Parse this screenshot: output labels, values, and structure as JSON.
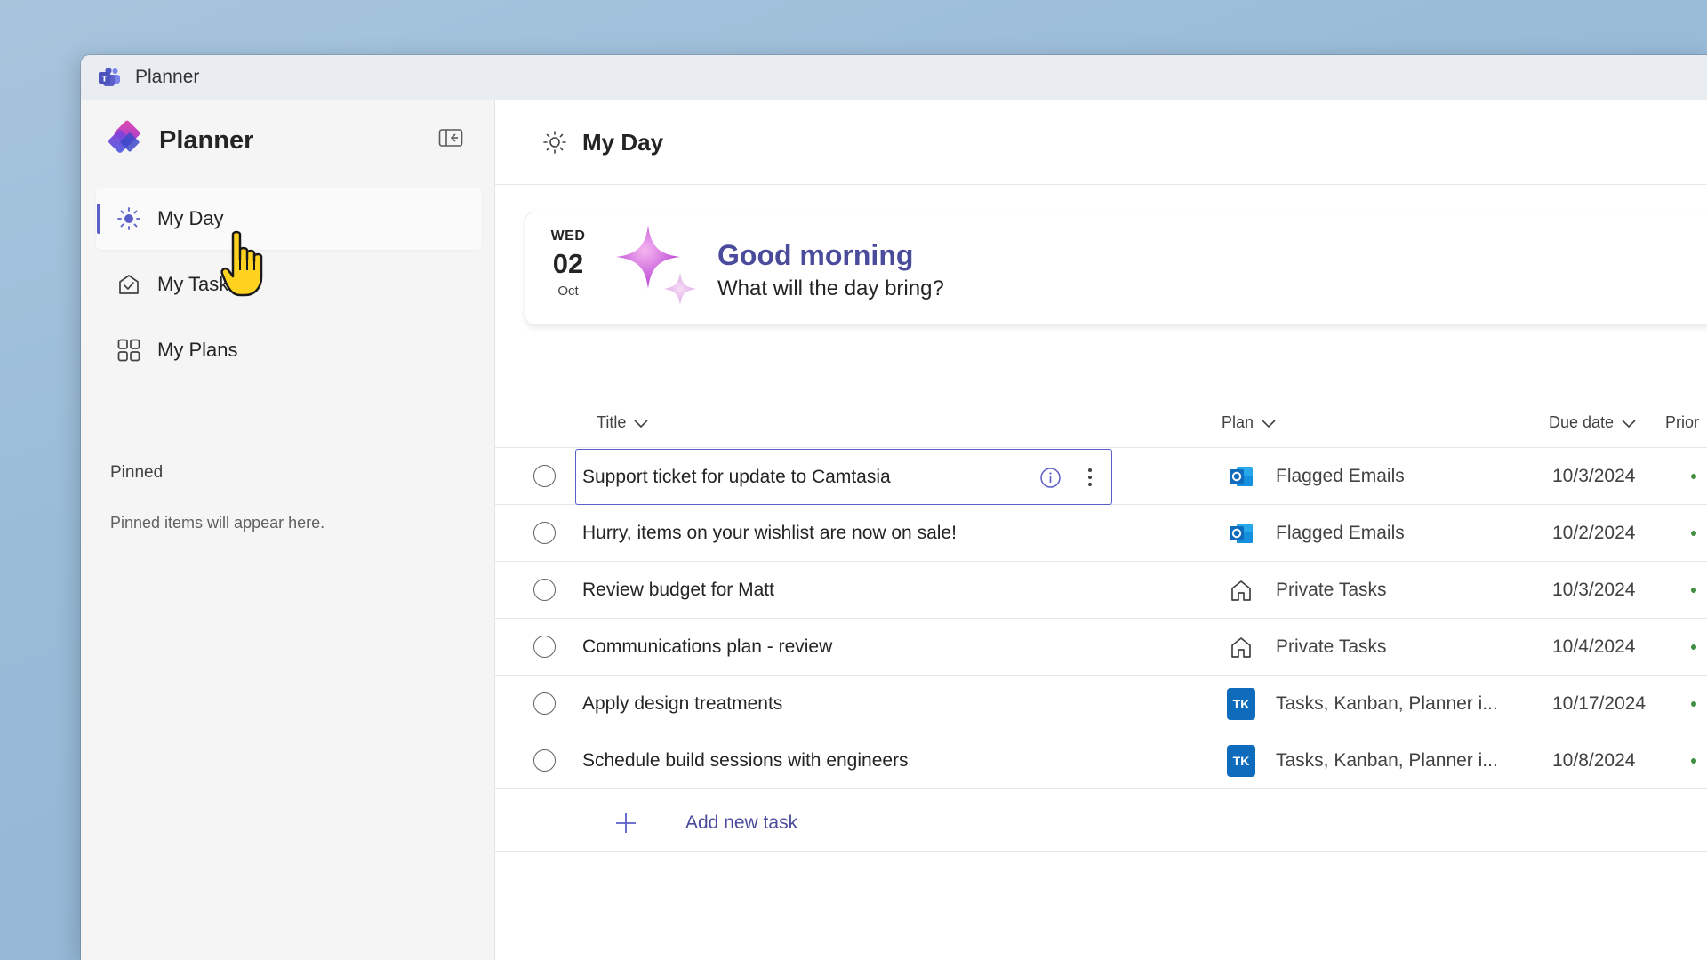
{
  "window": {
    "title": "Planner"
  },
  "sidebar": {
    "brand": "Planner",
    "nav": [
      {
        "label": "My Day",
        "icon": "sun-icon",
        "active": true
      },
      {
        "label": "My Tasks",
        "icon": "task-icon",
        "active": false
      },
      {
        "label": "My Plans",
        "icon": "grid-icon",
        "active": false
      }
    ],
    "pinned_title": "Pinned",
    "pinned_empty": "Pinned items will appear here."
  },
  "main": {
    "title": "My Day",
    "greeting": {
      "dow": "WED",
      "day": "02",
      "month": "Oct",
      "title": "Good morning",
      "subtitle": "What will the day bring?"
    },
    "columns": {
      "title": "Title",
      "plan": "Plan",
      "due": "Due date",
      "priority": "Prior"
    },
    "tasks": [
      {
        "title": "Support ticket for update to Camtasia",
        "plan": "Flagged Emails",
        "plan_icon": "outlook-icon",
        "due": "10/3/2024"
      },
      {
        "title": "Hurry, items on your wishlist are now on sale!",
        "plan": "Flagged Emails",
        "plan_icon": "outlook-icon",
        "due": "10/2/2024"
      },
      {
        "title": "Review budget for Matt",
        "plan": "Private Tasks",
        "plan_icon": "home-icon",
        "due": "10/3/2024"
      },
      {
        "title": "Communications plan - review",
        "plan": "Private Tasks",
        "plan_icon": "home-icon",
        "due": "10/4/2024"
      },
      {
        "title": "Apply design treatments",
        "plan": "Tasks, Kanban, Planner i...",
        "plan_icon": "plan-badge-icon",
        "badge": "TK",
        "due": "10/17/2024"
      },
      {
        "title": "Schedule build sessions with engineers",
        "plan": "Tasks, Kanban, Planner i...",
        "plan_icon": "plan-badge-icon",
        "badge": "TK",
        "due": "10/8/2024"
      }
    ],
    "add_task": "Add new task"
  },
  "colors": {
    "accent": "#5b5fc7",
    "greeting_title": "#4b4b9c",
    "badge": "#0f6cbd",
    "outlook": "#0f6cbd",
    "priority_dot": "#3f8f3f"
  }
}
